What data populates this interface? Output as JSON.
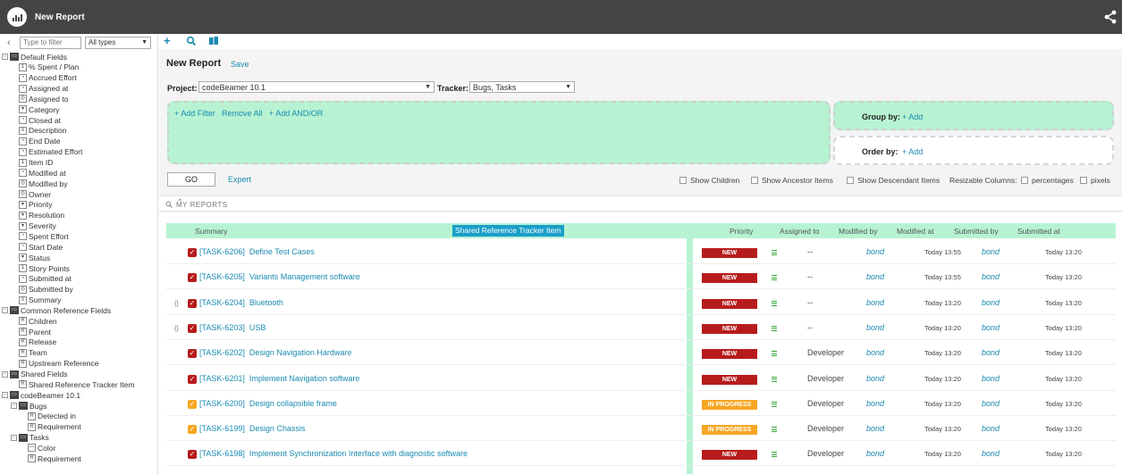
{
  "app": {
    "title": "New Report"
  },
  "left_panel": {
    "filter_placeholder": "Type to filter",
    "type_select": "All types",
    "tree": [
      {
        "label": "Default Fields",
        "icon": "folder",
        "level": 0,
        "collapse": "-"
      },
      {
        "label": "% Spent / Plan",
        "icon": "1",
        "level": 1
      },
      {
        "label": "Accrued Effort",
        "icon": "◔",
        "level": 1
      },
      {
        "label": "Assigned at",
        "icon": "◔",
        "level": 1
      },
      {
        "label": "Assigned to",
        "icon": "◎",
        "level": 1
      },
      {
        "label": "Category",
        "icon": "▾",
        "level": 1
      },
      {
        "label": "Closed at",
        "icon": "◔",
        "level": 1
      },
      {
        "label": "Description",
        "icon": "≡",
        "level": 1
      },
      {
        "label": "End Date",
        "icon": "◔",
        "level": 1
      },
      {
        "label": "Estimated Effort",
        "icon": "◔",
        "level": 1
      },
      {
        "label": "Item ID",
        "icon": "1",
        "level": 1
      },
      {
        "label": "Modified at",
        "icon": "◔",
        "level": 1
      },
      {
        "label": "Modified by",
        "icon": "◎",
        "level": 1
      },
      {
        "label": "Owner",
        "icon": "◎",
        "level": 1
      },
      {
        "label": "Priority",
        "icon": "▾",
        "level": 1
      },
      {
        "label": "Resolution",
        "icon": "▾",
        "level": 1
      },
      {
        "label": "Severity",
        "icon": "▾",
        "level": 1
      },
      {
        "label": "Spent Effort",
        "icon": "◔",
        "level": 1
      },
      {
        "label": "Start Date",
        "icon": "◔",
        "level": 1
      },
      {
        "label": "Status",
        "icon": "▾",
        "level": 1
      },
      {
        "label": "Story Points",
        "icon": "1",
        "level": 1
      },
      {
        "label": "Submitted at",
        "icon": "◔",
        "level": 1
      },
      {
        "label": "Submitted by",
        "icon": "◎",
        "level": 1
      },
      {
        "label": "Summary",
        "icon": "≡",
        "level": 1
      },
      {
        "label": "Common Reference Fields",
        "icon": "folder",
        "level": 0,
        "collapse": "-"
      },
      {
        "label": "Children",
        "icon": "R",
        "level": 1
      },
      {
        "label": "Parent",
        "icon": "R",
        "level": 1
      },
      {
        "label": "Release",
        "icon": "R",
        "level": 1
      },
      {
        "label": "Team",
        "icon": "R",
        "level": 1
      },
      {
        "label": "Upstream Reference",
        "icon": "R",
        "level": 1
      },
      {
        "label": "Shared Fields",
        "icon": "folder",
        "level": 0,
        "collapse": "-"
      },
      {
        "label": "Shared Reference Tracker Item",
        "icon": "R",
        "level": 1
      },
      {
        "label": "codeBeamer 10.1",
        "icon": "folder",
        "level": 0,
        "collapse": "-"
      },
      {
        "label": "Bugs",
        "icon": "folder",
        "level": 1,
        "collapse": "-"
      },
      {
        "label": "Detected in",
        "icon": "R",
        "level": 2
      },
      {
        "label": "Requirement",
        "icon": "R",
        "level": 2
      },
      {
        "label": "Tasks",
        "icon": "folder",
        "level": 1,
        "collapse": "-"
      },
      {
        "label": "Color",
        "icon": "—",
        "level": 2
      },
      {
        "label": "Requirement",
        "icon": "R",
        "level": 2
      }
    ]
  },
  "report": {
    "title": "New Report",
    "save_label": "Save",
    "project_label": "Project:",
    "project_value": "codeBeamer 10.1",
    "tracker_label": "Tracker:",
    "tracker_value": "Bugs, Tasks",
    "add_filter": "+ Add Filter",
    "remove_all": "Remove All",
    "add_and_or": "+ Add AND/OR",
    "group_by_label": "Group by:",
    "group_by_add": "+ Add",
    "order_by_label": "Order by:",
    "order_by_add": "+ Add",
    "go_label": "GO",
    "expert_label": "Expert",
    "show_children": "Show Children",
    "show_ancestor": "Show Ancestor Items",
    "show_descendant": "Show Descendant Items",
    "resizable_columns": "Resizable Columns:",
    "percentages": "percentages",
    "pixels": "pixels",
    "my_reports": "MY REPORTS"
  },
  "table": {
    "columns": [
      "Summary",
      "Shared Reference Tracker Item",
      "Priority",
      "Assigned to",
      "Modified by",
      "Modified at",
      "Submitted by",
      "Submitted at"
    ],
    "rows": [
      {
        "prefix": "",
        "check_color": "#b71c1c",
        "id": "[TASK-6206]",
        "summary": "Define Test Cases",
        "status": "NEW",
        "status_color": "#b71c1c",
        "assigned": "--",
        "modified_by": "bond",
        "modified_at": "Today 13:55",
        "submitted_by": "bond",
        "submitted_at": "Today 13:20"
      },
      {
        "prefix": "",
        "check_color": "#b71c1c",
        "id": "[TASK-6205]",
        "summary": "Variants Management software",
        "status": "NEW",
        "status_color": "#b71c1c",
        "assigned": "--",
        "modified_by": "bond",
        "modified_at": "Today 13:55",
        "submitted_by": "bond",
        "submitted_at": "Today 13:20"
      },
      {
        "prefix": "{}",
        "check_color": "#b71c1c",
        "id": "[TASK-6204]",
        "summary": "Bluetooth",
        "status": "NEW",
        "status_color": "#b71c1c",
        "assigned": "--",
        "modified_by": "bond",
        "modified_at": "Today 13:20",
        "submitted_by": "bond",
        "submitted_at": "Today 13:20"
      },
      {
        "prefix": "{}",
        "check_color": "#b71c1c",
        "id": "[TASK-6203]",
        "summary": "USB",
        "status": "NEW",
        "status_color": "#b71c1c",
        "assigned": "--",
        "modified_by": "bond",
        "modified_at": "Today 13:20",
        "submitted_by": "bond",
        "submitted_at": "Today 13:20"
      },
      {
        "prefix": "",
        "check_color": "#b71c1c",
        "id": "[TASK-6202]",
        "summary": "Design Navigation Hardware",
        "status": "NEW",
        "status_color": "#b71c1c",
        "assigned": "Developer",
        "modified_by": "bond",
        "modified_at": "Today 13:20",
        "submitted_by": "bond",
        "submitted_at": "Today 13:20"
      },
      {
        "prefix": "",
        "check_color": "#b71c1c",
        "id": "[TASK-6201]",
        "summary": "Implement Navigation software",
        "status": "NEW",
        "status_color": "#b71c1c",
        "assigned": "Developer",
        "modified_by": "bond",
        "modified_at": "Today 13:20",
        "submitted_by": "bond",
        "submitted_at": "Today 13:20"
      },
      {
        "prefix": "",
        "check_color": "#f6a623",
        "id": "[TASK-6200]",
        "summary": "Design collapsible frame",
        "status": "IN PROGRESS",
        "status_color": "#f6a623",
        "assigned": "Developer",
        "modified_by": "bond",
        "modified_at": "Today 13:20",
        "submitted_by": "bond",
        "submitted_at": "Today 13:20"
      },
      {
        "prefix": "",
        "check_color": "#f6a623",
        "id": "[TASK-6199]",
        "summary": "Design Chassis",
        "status": "IN PROGRESS",
        "status_color": "#f6a623",
        "assigned": "Developer",
        "modified_by": "bond",
        "modified_at": "Today 13:20",
        "submitted_by": "bond",
        "submitted_at": "Today 13:20"
      },
      {
        "prefix": "",
        "check_color": "#b71c1c",
        "id": "[TASK-6198]",
        "summary": "Implement Synchronization Interface with diagnostic software",
        "status": "NEW",
        "status_color": "#b71c1c",
        "assigned": "Developer",
        "modified_by": "bond",
        "modified_at": "Today 13:20",
        "submitted_by": "bond",
        "submitted_at": "Today 13:20"
      }
    ]
  }
}
